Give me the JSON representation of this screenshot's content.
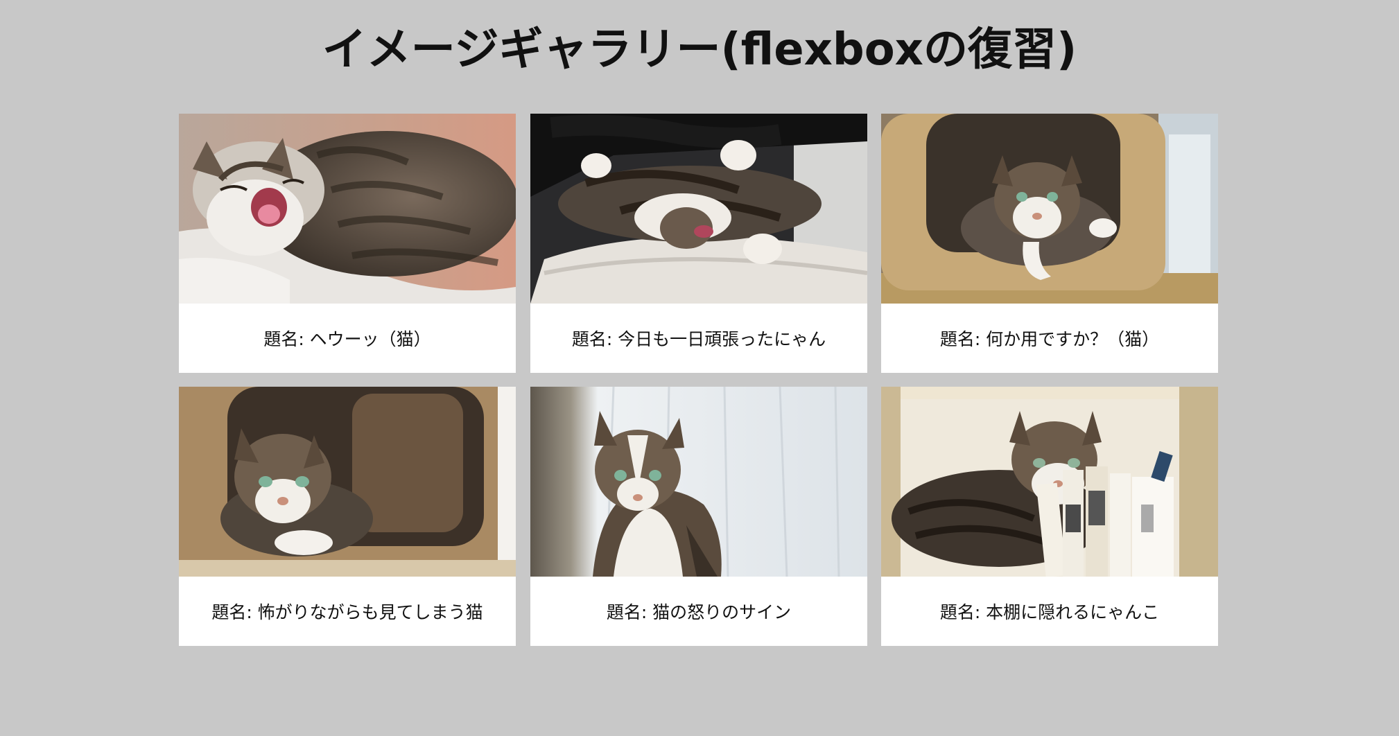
{
  "page": {
    "title": "イメージギャラリー(flexboxの復習)"
  },
  "gallery": {
    "items": [
      {
        "caption": "題名: ヘウーッ（猫）",
        "photo_subject": "yawning-tabby-cat-on-blanket"
      },
      {
        "caption": "題名: 今日も一日頑張ったにゃん",
        "photo_subject": "cat-lying-on-back-on-chair"
      },
      {
        "caption": "題名: 何か用ですか？（猫）",
        "photo_subject": "cat-in-cardboard-box-by-window"
      },
      {
        "caption": "題名: 怖がりながらも見てしまう猫",
        "photo_subject": "cat-peeking-from-cardboard-box"
      },
      {
        "caption": "題名: 猫の怒りのサイン",
        "photo_subject": "cat-sitting-by-curtain"
      },
      {
        "caption": "題名: 本棚に隠れるにゃんこ",
        "photo_subject": "cat-in-bookshelf"
      }
    ]
  },
  "colors": {
    "background": "#c8c8c8",
    "card": "#ffffff",
    "text": "#111111"
  }
}
